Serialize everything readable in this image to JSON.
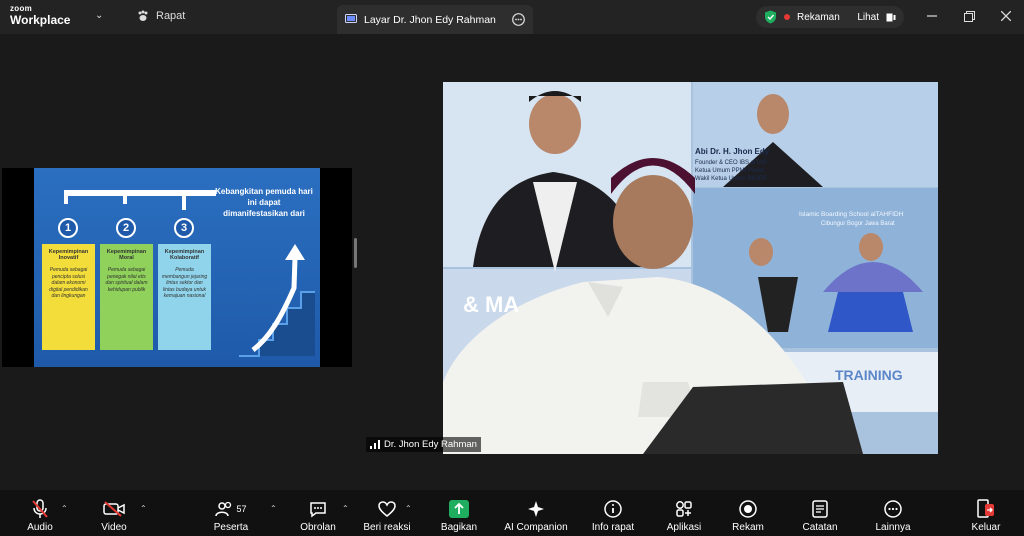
{
  "titlebar": {
    "brand_top": "zoom",
    "brand_bottom": "Workplace",
    "meeting_label": "Rapat",
    "share_tab": "Layar Dr. Jhon Edy Rahman",
    "recording_label": "Rekaman",
    "view_label": "Lihat"
  },
  "slide": {
    "title": "Kebangkitan pemuda hari ini dapat dimanifestasikan dari",
    "items": [
      {
        "num": "1",
        "heading": "Kepemimpinan Inovatif",
        "text": "Pemuda sebagai pencipta solusi dalam ekonomi digital pendidikan dan lingkungan",
        "color": "#f3dd3a"
      },
      {
        "num": "2",
        "heading": "Kepemimpinan Moral",
        "text": "Pemuda sebagai penegak nilai etis dan spiritual dalam kehidupan publik",
        "color": "#8fd15a"
      },
      {
        "num": "3",
        "heading": "Kepemimpinan Kolaboratif",
        "text": "Pemuda membangun jejaring lintas sektor dan lintas budaya untuk kemajuan nasional",
        "color": "#8fd4ea"
      }
    ]
  },
  "video": {
    "participant_name": "Dr. Jhon Edy Rahman",
    "banner_name": "Abi Dr. H. Jhon Edy",
    "banner_role1": "Founder & CEO IBS alTAR",
    "banner_role2": "Ketua Umum PPMI Pusat",
    "banner_role3": "Wakil Ketua Umum BKsPP",
    "banner_school": "Islamic Boarding School alTAHFIDH",
    "banner_location": "Cibungur Bogor Jawa Barat",
    "banner_training": "TRAINING",
    "banner_amp": "& MA"
  },
  "toolbar": {
    "items": [
      {
        "label": "Audio",
        "icon": "mic-muted-icon"
      },
      {
        "label": "Video",
        "icon": "video-off-icon"
      },
      {
        "label": "Peserta",
        "icon": "participants-icon",
        "count": "57"
      },
      {
        "label": "Obrolan",
        "icon": "chat-icon"
      },
      {
        "label": "Beri reaksi",
        "icon": "heart-icon"
      },
      {
        "label": "Bagikan",
        "icon": "share-icon"
      },
      {
        "label": "AI Companion",
        "icon": "sparkle-icon"
      },
      {
        "label": "Info rapat",
        "icon": "info-icon"
      },
      {
        "label": "Aplikasi",
        "icon": "apps-icon"
      },
      {
        "label": "Rekam",
        "icon": "record-icon"
      },
      {
        "label": "Catatan",
        "icon": "notes-icon"
      },
      {
        "label": "Lainnya",
        "icon": "more-icon"
      },
      {
        "label": "Keluar",
        "icon": "leave-icon"
      }
    ]
  },
  "colors": {
    "accent_green": "#1fae5f",
    "record_red": "#e53935",
    "slide_blue": "#2b6fc0"
  }
}
